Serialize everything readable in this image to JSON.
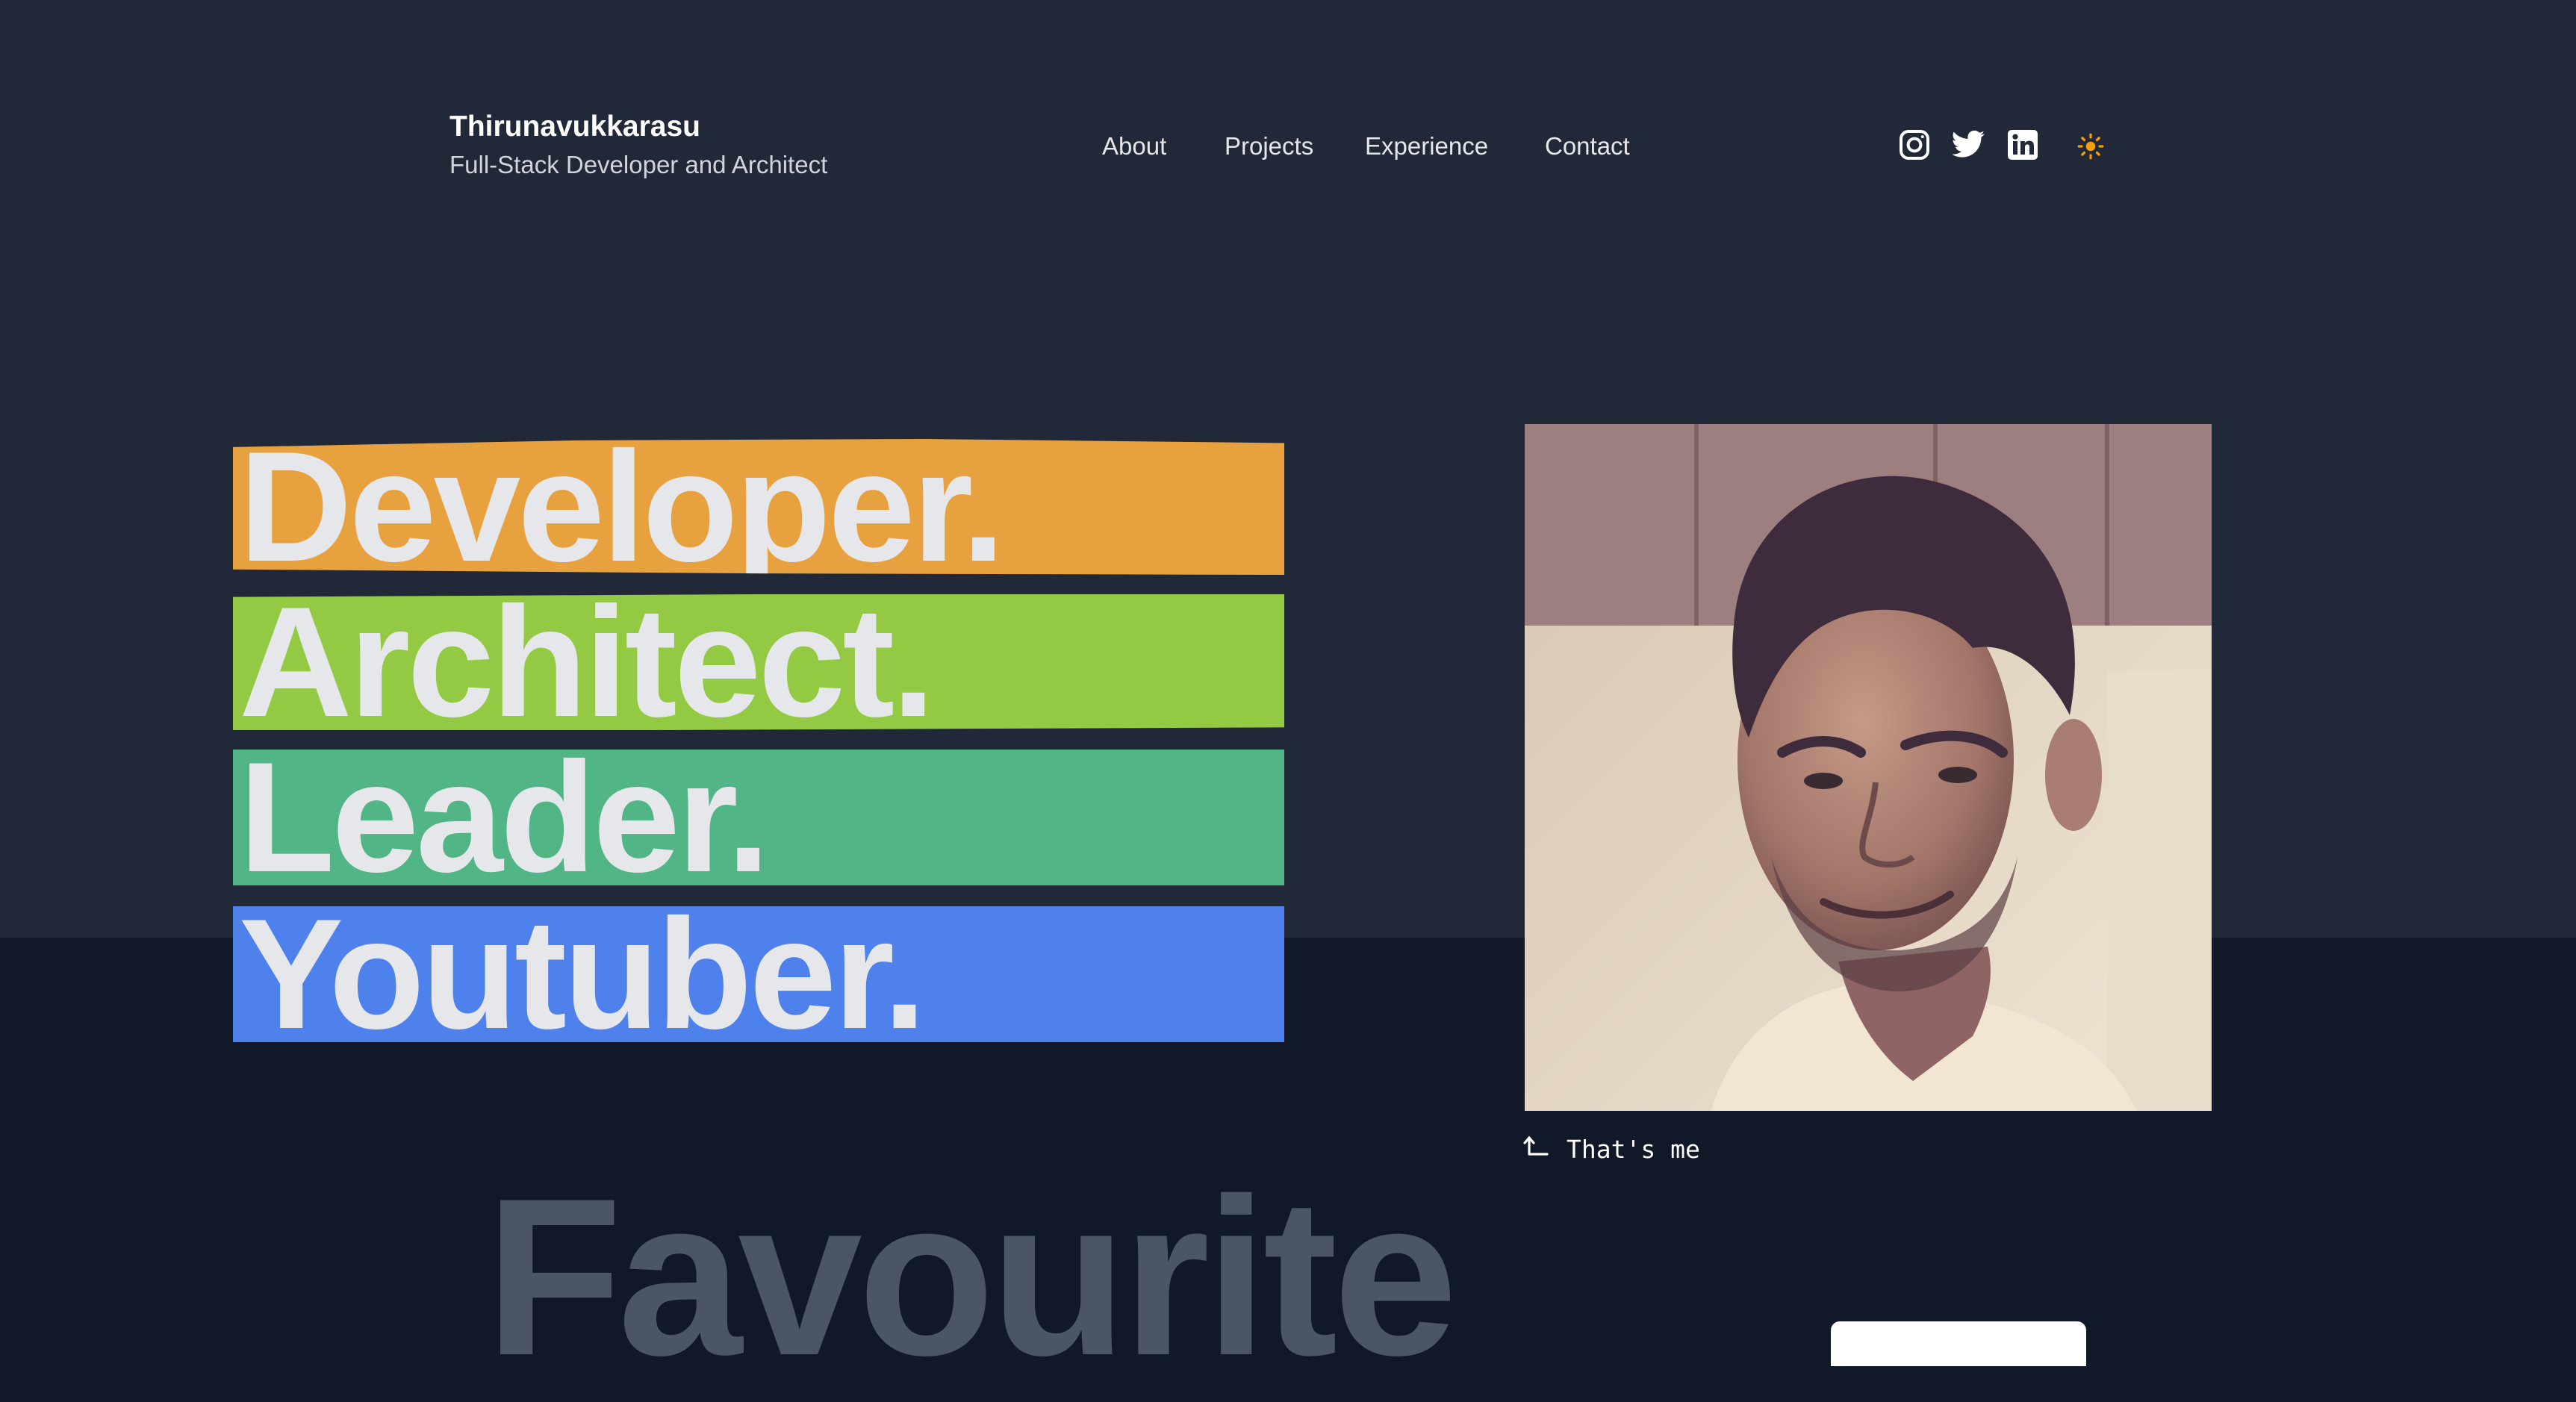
{
  "header": {
    "brand_name": "Thirunavukkarasu",
    "tagline": "Full-Stack Developer and Architect",
    "nav": [
      "About",
      "Projects",
      "Experience",
      "Contact"
    ],
    "social_icons": [
      "instagram-icon",
      "twitter-icon",
      "linkedin-icon"
    ],
    "theme_toggle_icon": "sun-icon"
  },
  "hero": {
    "words": [
      {
        "label": "Developer.",
        "color": "#e8a13f"
      },
      {
        "label": "Architect.",
        "color": "#94c943"
      },
      {
        "label": "Leader.",
        "color": "#52b586"
      },
      {
        "label": "Youtuber.",
        "color": "#4f81ec"
      }
    ],
    "photo_caption": "That's me",
    "caption_icon": "arrow-up-left-icon"
  },
  "section": {
    "heading": "Favourite"
  },
  "colors": {
    "top_background": "#212837",
    "bottom_background": "#111827",
    "accent_sun": "#f59e0b",
    "heading_muted": "#4b5563"
  }
}
